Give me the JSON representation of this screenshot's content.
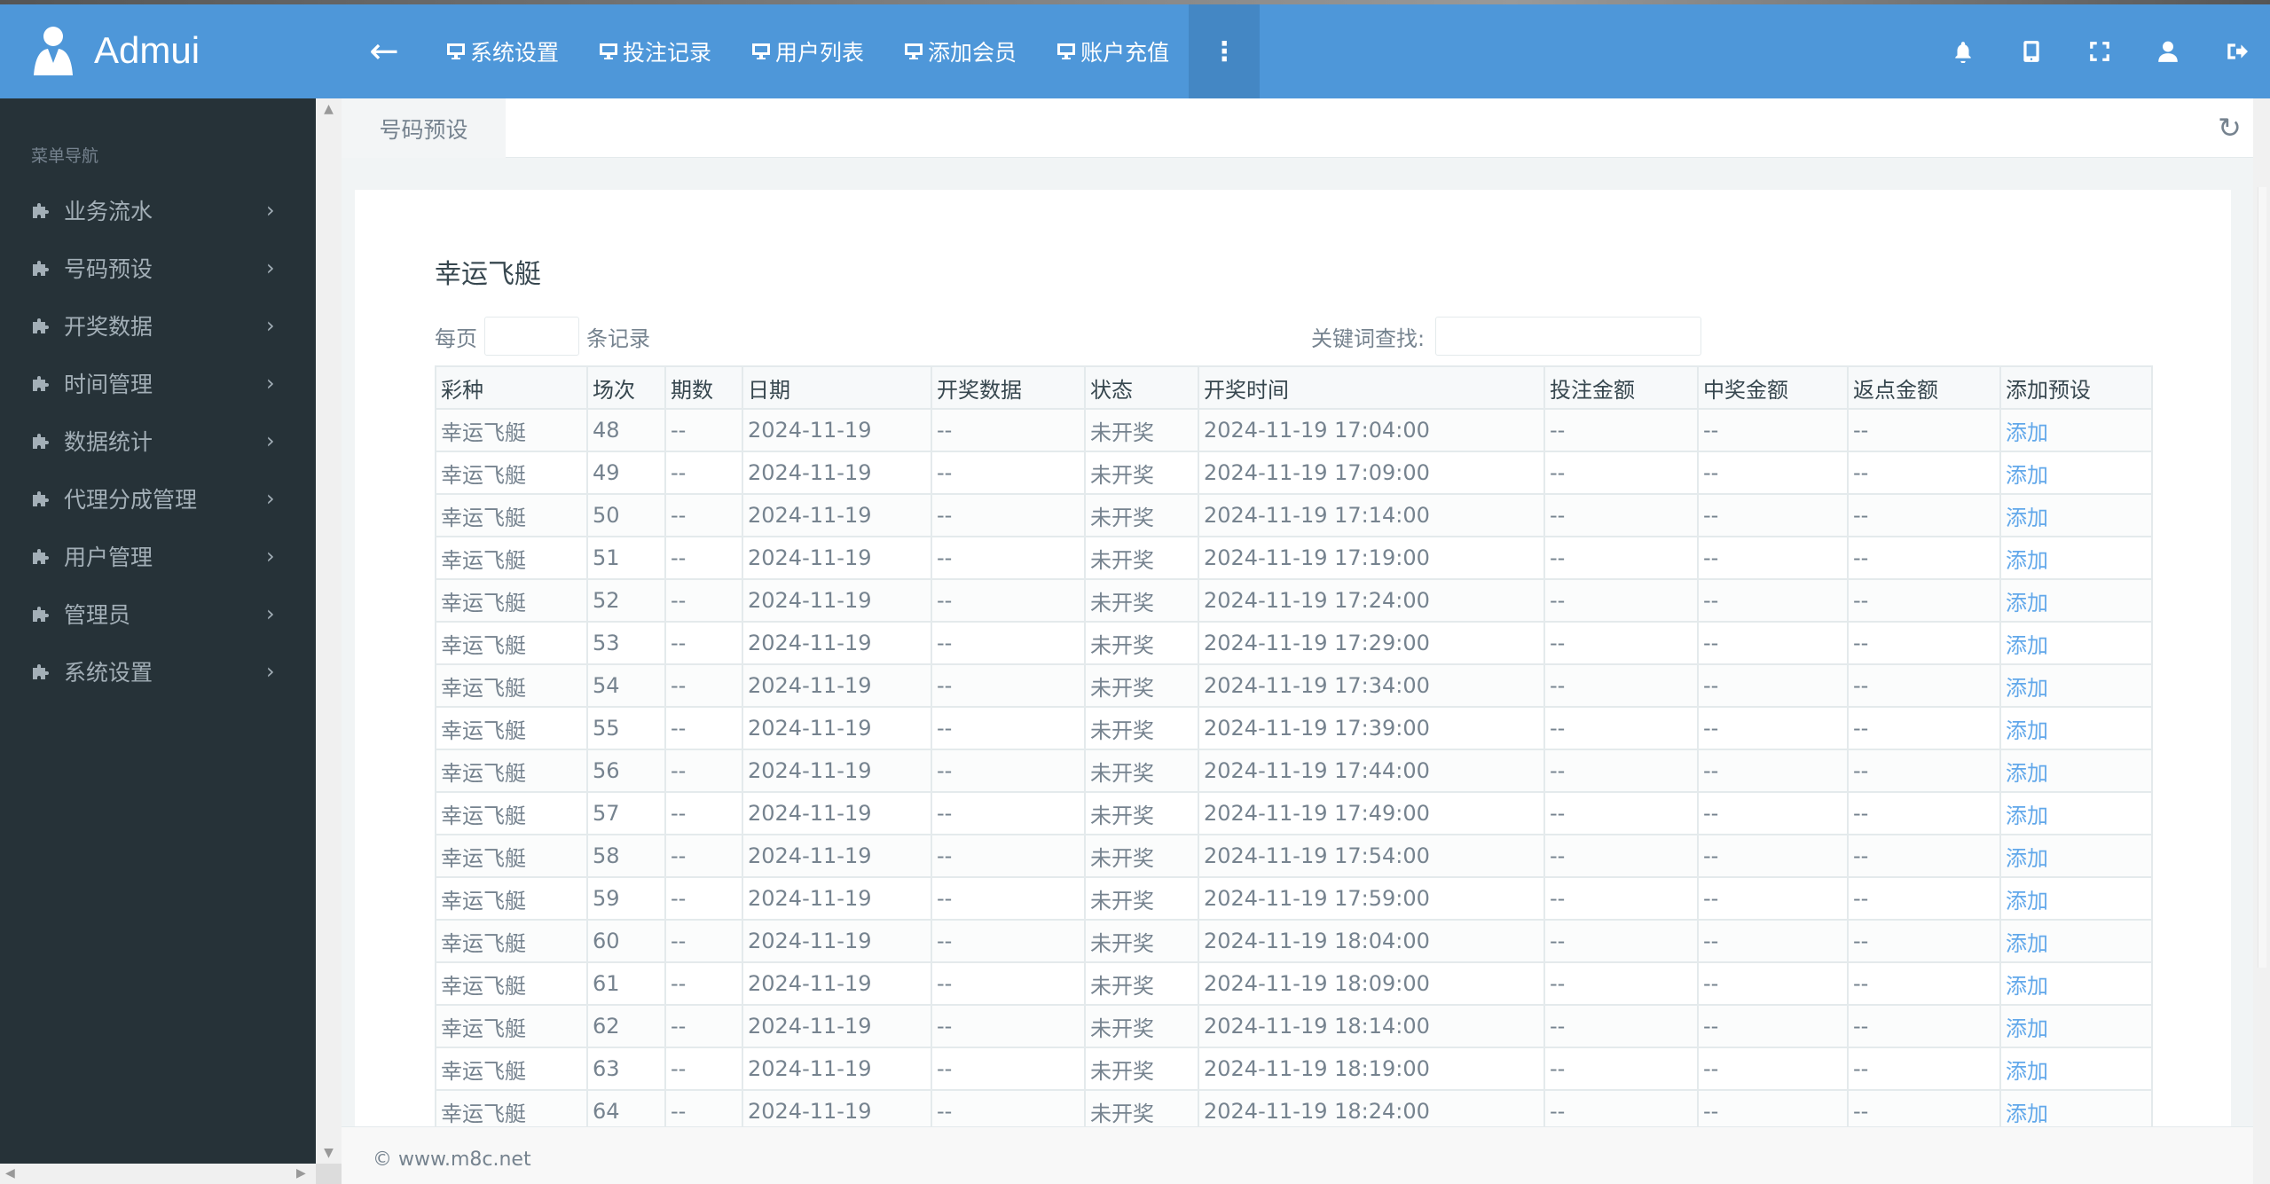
{
  "header": {
    "brand": "Admui",
    "nav": [
      "系统设置",
      "投注记录",
      "用户列表",
      "添加会员",
      "账户充值"
    ],
    "accent": "#4e97d9"
  },
  "sidebar": {
    "title": "菜单导航",
    "items": [
      "业务流水",
      "号码预设",
      "开奖数据",
      "时间管理",
      "数据统计",
      "代理分成管理",
      "用户管理",
      "管理员",
      "系统设置"
    ]
  },
  "tabs": {
    "active": "号码预设"
  },
  "main": {
    "title": "幸运飞艇",
    "per_page_prefix": "每页",
    "per_page_suffix": "条记录",
    "search_label": "关键词查找:",
    "columns": [
      "彩种",
      "场次",
      "期数",
      "日期",
      "开奖数据",
      "状态",
      "开奖时间",
      "投注金额",
      "中奖金额",
      "返点金额",
      "添加预设"
    ],
    "rows": [
      [
        "幸运飞艇",
        "48",
        "--",
        "2024-11-19",
        "--",
        "未开奖",
        "2024-11-19 17:04:00",
        "--",
        "--",
        "--",
        "添加"
      ],
      [
        "幸运飞艇",
        "49",
        "--",
        "2024-11-19",
        "--",
        "未开奖",
        "2024-11-19 17:09:00",
        "--",
        "--",
        "--",
        "添加"
      ],
      [
        "幸运飞艇",
        "50",
        "--",
        "2024-11-19",
        "--",
        "未开奖",
        "2024-11-19 17:14:00",
        "--",
        "--",
        "--",
        "添加"
      ],
      [
        "幸运飞艇",
        "51",
        "--",
        "2024-11-19",
        "--",
        "未开奖",
        "2024-11-19 17:19:00",
        "--",
        "--",
        "--",
        "添加"
      ],
      [
        "幸运飞艇",
        "52",
        "--",
        "2024-11-19",
        "--",
        "未开奖",
        "2024-11-19 17:24:00",
        "--",
        "--",
        "--",
        "添加"
      ],
      [
        "幸运飞艇",
        "53",
        "--",
        "2024-11-19",
        "--",
        "未开奖",
        "2024-11-19 17:29:00",
        "--",
        "--",
        "--",
        "添加"
      ],
      [
        "幸运飞艇",
        "54",
        "--",
        "2024-11-19",
        "--",
        "未开奖",
        "2024-11-19 17:34:00",
        "--",
        "--",
        "--",
        "添加"
      ],
      [
        "幸运飞艇",
        "55",
        "--",
        "2024-11-19",
        "--",
        "未开奖",
        "2024-11-19 17:39:00",
        "--",
        "--",
        "--",
        "添加"
      ],
      [
        "幸运飞艇",
        "56",
        "--",
        "2024-11-19",
        "--",
        "未开奖",
        "2024-11-19 17:44:00",
        "--",
        "--",
        "--",
        "添加"
      ],
      [
        "幸运飞艇",
        "57",
        "--",
        "2024-11-19",
        "--",
        "未开奖",
        "2024-11-19 17:49:00",
        "--",
        "--",
        "--",
        "添加"
      ],
      [
        "幸运飞艇",
        "58",
        "--",
        "2024-11-19",
        "--",
        "未开奖",
        "2024-11-19 17:54:00",
        "--",
        "--",
        "--",
        "添加"
      ],
      [
        "幸运飞艇",
        "59",
        "--",
        "2024-11-19",
        "--",
        "未开奖",
        "2024-11-19 17:59:00",
        "--",
        "--",
        "--",
        "添加"
      ],
      [
        "幸运飞艇",
        "60",
        "--",
        "2024-11-19",
        "--",
        "未开奖",
        "2024-11-19 18:04:00",
        "--",
        "--",
        "--",
        "添加"
      ],
      [
        "幸运飞艇",
        "61",
        "--",
        "2024-11-19",
        "--",
        "未开奖",
        "2024-11-19 18:09:00",
        "--",
        "--",
        "--",
        "添加"
      ],
      [
        "幸运飞艇",
        "62",
        "--",
        "2024-11-19",
        "--",
        "未开奖",
        "2024-11-19 18:14:00",
        "--",
        "--",
        "--",
        "添加"
      ],
      [
        "幸运飞艇",
        "63",
        "--",
        "2024-11-19",
        "--",
        "未开奖",
        "2024-11-19 18:19:00",
        "--",
        "--",
        "--",
        "添加"
      ],
      [
        "幸运飞艇",
        "64",
        "--",
        "2024-11-19",
        "--",
        "未开奖",
        "2024-11-19 18:24:00",
        "--",
        "--",
        "--",
        "添加"
      ]
    ]
  },
  "footer": {
    "copyright": "© www.m8c.net"
  },
  "icons": {
    "nav": "monitor-icon",
    "sidebar": "puzzle-icon",
    "right": [
      "bell-icon",
      "mobile-icon",
      "fullscreen-icon",
      "user-icon",
      "logout-icon"
    ]
  }
}
